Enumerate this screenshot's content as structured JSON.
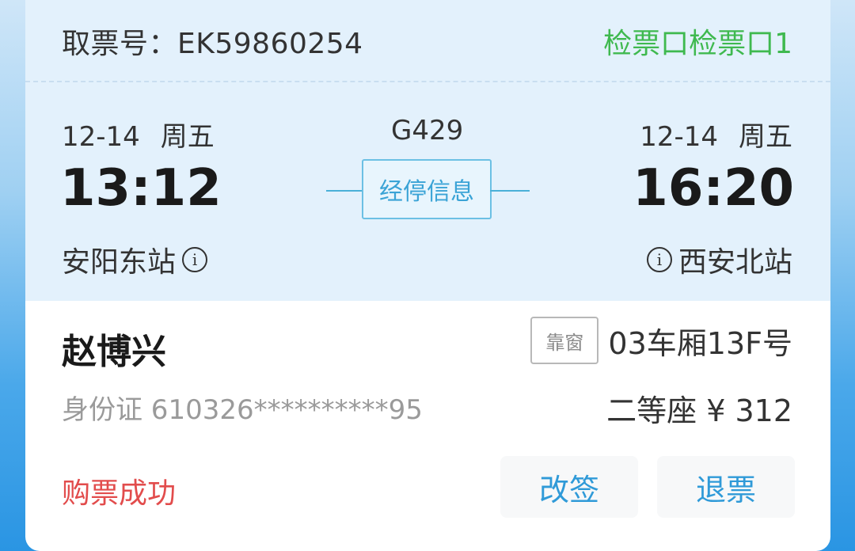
{
  "ticket": {
    "ticket_no_label": "取票号：EK59860254",
    "gate": "检票口检票口1"
  },
  "departure": {
    "date": "12-14",
    "weekday": "周五",
    "time": "13:12",
    "station": "安阳东站"
  },
  "arrival": {
    "date": "12-14",
    "weekday": "周五",
    "time": "16:20",
    "station": "西安北站"
  },
  "train": {
    "number": "G429",
    "stop_info_label": "经停信息"
  },
  "passenger": {
    "name": "赵博兴",
    "id_text": "身份证 610326**********95",
    "window_label": "靠窗",
    "seat": "03车厢13F号",
    "class_price": "二等座 ¥ 312"
  },
  "status": {
    "text": "购票成功"
  },
  "actions": {
    "change_label": "改签",
    "refund_label": "退票"
  },
  "colors": {
    "gate": "#3fb94f",
    "status": "#e24c4c",
    "action": "#2f9ad8",
    "accent": "#3aa3d6",
    "header_bg": "#e3f1fc"
  },
  "icons": {
    "station_info": "info-circle-icon"
  }
}
